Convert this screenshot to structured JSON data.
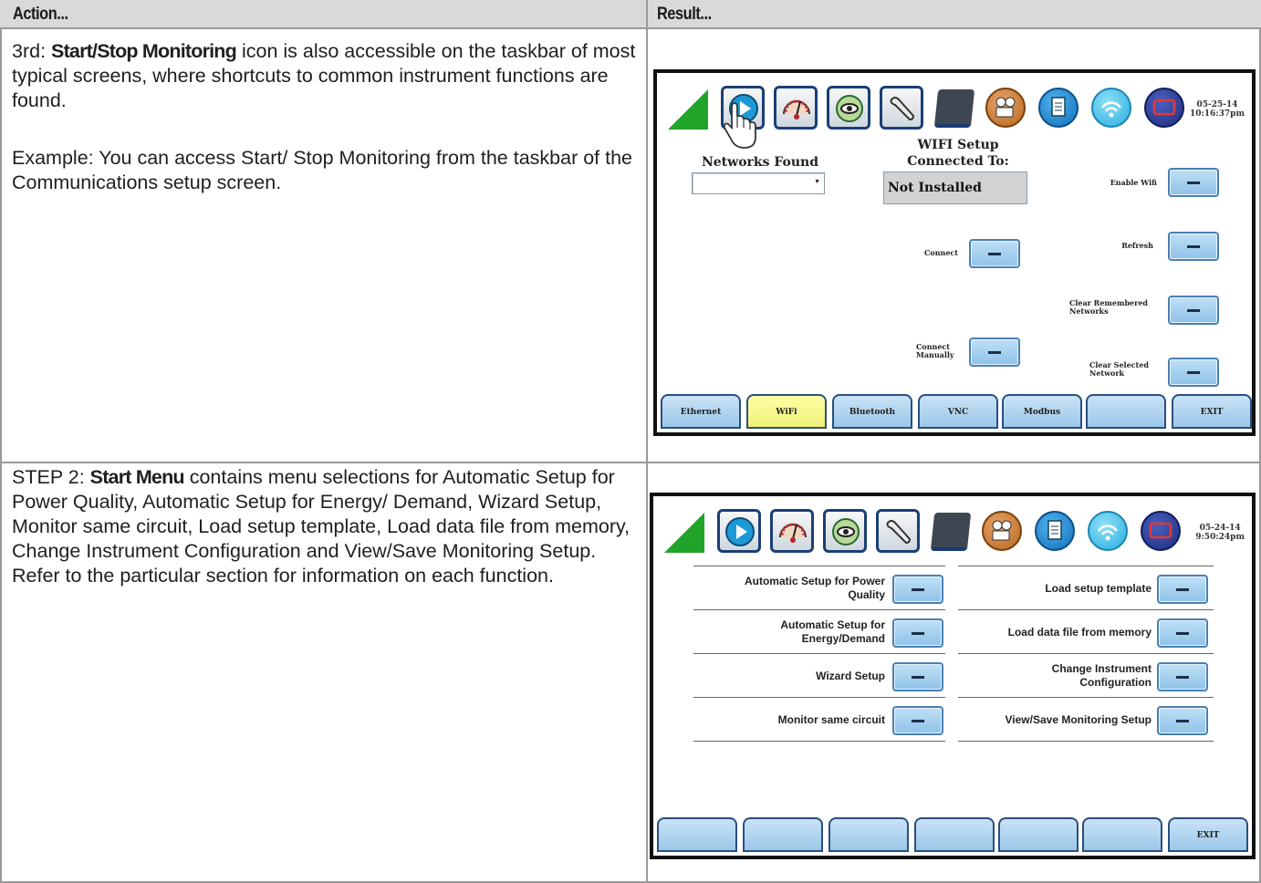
{
  "table": {
    "header": {
      "action": "Action...",
      "result": "Result..."
    }
  },
  "row1": {
    "action_prefix": "3rd: ",
    "action_bold": "Start/Stop Monitoring",
    "action_rest": " icon is also accessible on the taskbar of most typical screens, where shortcuts to common instrument functions are found.",
    "example": "Example: You can access Start/ Stop Monitoring from the taskbar of the Communications setup screen.",
    "screen": {
      "datetime_date": "05-25-14",
      "datetime_time": "10:16:37pm",
      "wifi_setup_title": "WIFI Setup",
      "connected_to_label": "Connected To:",
      "networks_found_label": "Networks Found",
      "connected_value": "Not Installed",
      "enable_wifi": "Enable Wifi",
      "connect": "Connect",
      "refresh": "Refresh",
      "clear_remembered_1": "Clear Remembered",
      "clear_remembered_2": "Networks",
      "connect_manually_1": "Connect",
      "connect_manually_2": "Manually",
      "clear_selected_1": "Clear Selected",
      "clear_selected_2": "Network",
      "tabs": [
        "Ethernet",
        "WiFi",
        "Bluetooth",
        "VNC",
        "Modbus",
        "",
        "EXIT"
      ]
    }
  },
  "row2": {
    "action_prefix": "STEP 2: ",
    "action_bold": "Start Menu",
    "action_rest": " contains menu selections for Automatic Setup for Power Quality, Automatic Setup for Energy/ Demand, Wizard Setup, Monitor same circuit, Load setup template, Load data file from memory, Change Instrument Configuration and View/Save Monitoring Setup. Refer to the particular section for information on each function.",
    "screen": {
      "datetime_date": "05-24-14",
      "datetime_time": "9:50:24pm",
      "left_items": [
        [
          "Automatic Setup for Power",
          "Quality"
        ],
        [
          "Automatic Setup for",
          "Energy/Demand"
        ],
        [
          "Wizard Setup",
          ""
        ],
        [
          "Monitor same circuit",
          ""
        ]
      ],
      "right_items": [
        [
          "Load setup template",
          ""
        ],
        [
          "Load data file from memory",
          ""
        ],
        [
          "Change Instrument",
          "Configuration"
        ],
        [
          "View/Save Monitoring Setup",
          ""
        ]
      ],
      "tabs": [
        "",
        "",
        "",
        "",
        "",
        "",
        "EXIT"
      ]
    }
  },
  "icons": [
    "start-stop-icon",
    "meter-icon",
    "scope-icon",
    "wrench-icon",
    "tablet-icon",
    "camera-icon",
    "document-icon",
    "wifi-icon",
    "screen-icon"
  ],
  "colors": {
    "header_bg": "#d9d9d9",
    "button": "#9cc7e8",
    "active_tab": "#ffffa5",
    "triangle": "#22a32a"
  }
}
